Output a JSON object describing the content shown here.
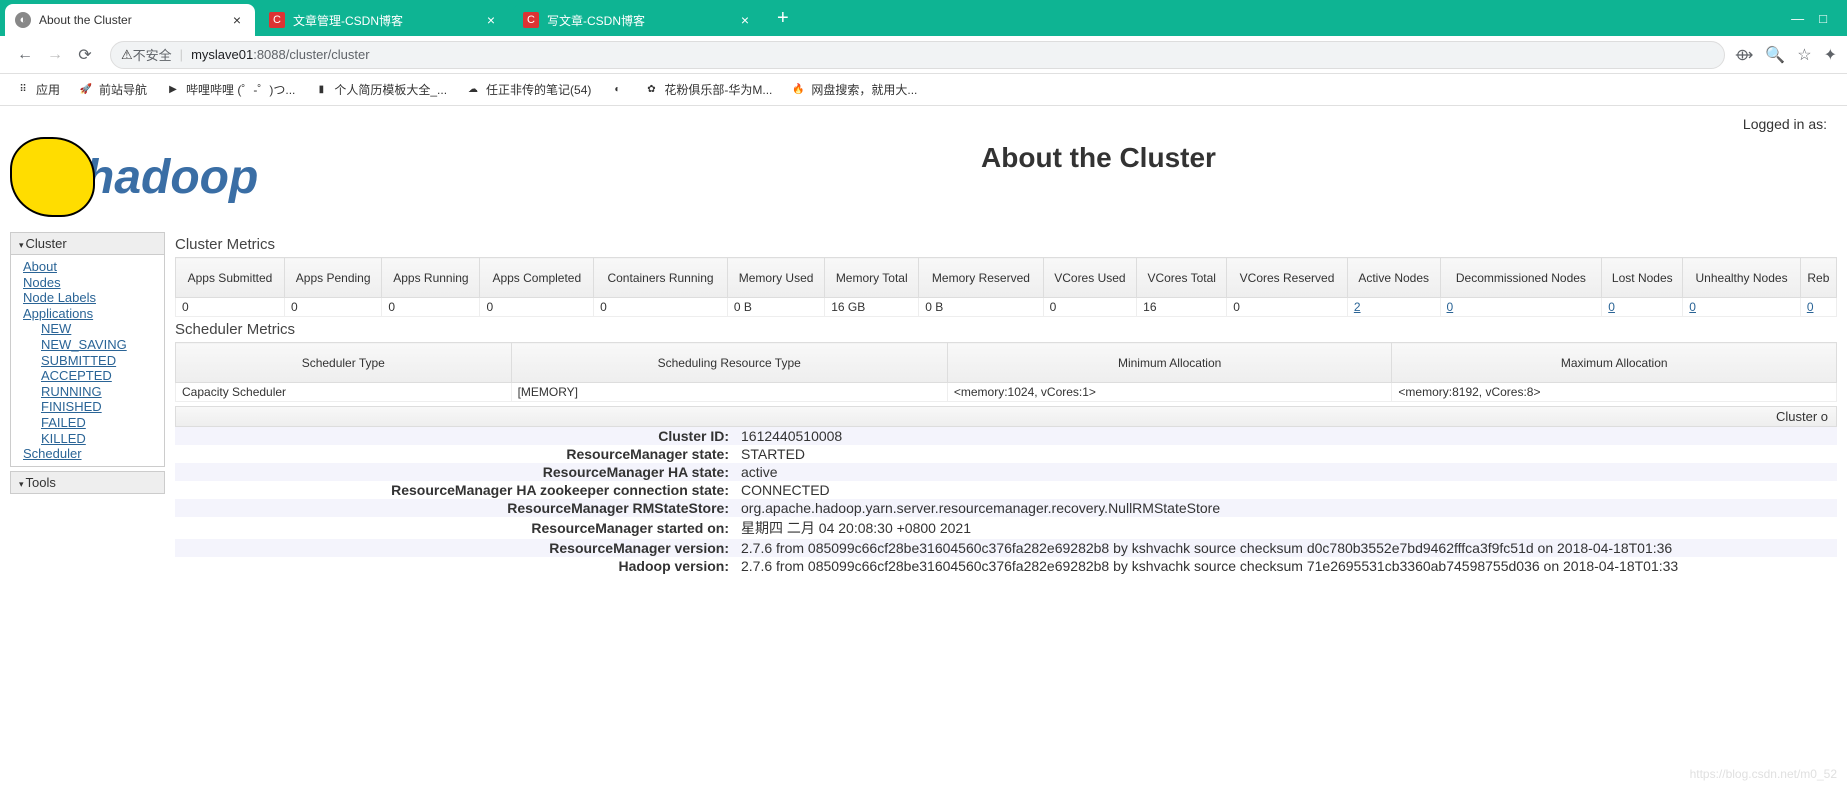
{
  "browser": {
    "tabs": [
      {
        "title": "About the Cluster",
        "favicon": "globe",
        "active": true
      },
      {
        "title": "文章管理-CSDN博客",
        "favicon": "C",
        "active": false
      },
      {
        "title": "写文章-CSDN博客",
        "favicon": "C",
        "active": false
      }
    ],
    "insecure_label": "不安全",
    "url_host": "myslave01",
    "url_rest": ":8088/cluster/cluster",
    "bookmarks": [
      {
        "label": "应用",
        "icon": "apps"
      },
      {
        "label": "前站导航",
        "icon": "rocket"
      },
      {
        "label": "哔哩哔哩 (゜-゜)つ...",
        "icon": "bili"
      },
      {
        "label": "个人简历模板大全_...",
        "icon": "doc"
      },
      {
        "label": "任正非传的笔记(54)",
        "icon": "note"
      },
      {
        "label": "",
        "icon": "globe"
      },
      {
        "label": "花粉俱乐部-华为M...",
        "icon": "hw"
      },
      {
        "label": "网盘搜索，就用大...",
        "icon": "fire"
      }
    ]
  },
  "page": {
    "logged_in": "Logged in as:",
    "logo_text": "hadoop",
    "title": "About the Cluster"
  },
  "sidebar": {
    "cluster_hdr": "Cluster",
    "cluster_items": [
      "About",
      "Nodes",
      "Node Labels",
      "Applications"
    ],
    "app_states": [
      "NEW",
      "NEW_SAVING",
      "SUBMITTED",
      "ACCEPTED",
      "RUNNING",
      "FINISHED",
      "FAILED",
      "KILLED"
    ],
    "scheduler": "Scheduler",
    "tools_hdr": "Tools"
  },
  "cluster_metrics": {
    "title": "Cluster Metrics",
    "headers": [
      "Apps Submitted",
      "Apps Pending",
      "Apps Running",
      "Apps Completed",
      "Containers Running",
      "Memory Used",
      "Memory Total",
      "Memory Reserved",
      "VCores Used",
      "VCores Total",
      "VCores Reserved",
      "Active Nodes",
      "Decommissioned Nodes",
      "Lost Nodes",
      "Unhealthy Nodes",
      "Reb"
    ],
    "values": [
      "0",
      "0",
      "0",
      "0",
      "0",
      "0 B",
      "16 GB",
      "0 B",
      "0",
      "16",
      "0",
      "2",
      "0",
      "0",
      "0",
      "0"
    ],
    "links_from_index": 11
  },
  "scheduler_metrics": {
    "title": "Scheduler Metrics",
    "headers": [
      "Scheduler Type",
      "Scheduling Resource Type",
      "Minimum Allocation",
      "Maximum Allocation"
    ],
    "values": [
      "Capacity Scheduler",
      "[MEMORY]",
      "<memory:1024, vCores:1>",
      "<memory:8192, vCores:8>"
    ]
  },
  "overview": {
    "header": "Cluster o",
    "rows": [
      {
        "k": "Cluster ID:",
        "v": "1612440510008"
      },
      {
        "k": "ResourceManager state:",
        "v": "STARTED"
      },
      {
        "k": "ResourceManager HA state:",
        "v": "active"
      },
      {
        "k": "ResourceManager HA zookeeper connection state:",
        "v": "CONNECTED"
      },
      {
        "k": "ResourceManager RMStateStore:",
        "v": "org.apache.hadoop.yarn.server.resourcemanager.recovery.NullRMStateStore"
      },
      {
        "k": "ResourceManager started on:",
        "v": "星期四 二月 04 20:08:30 +0800 2021"
      },
      {
        "k": "ResourceManager version:",
        "v": "2.7.6 from 085099c66cf28be31604560c376fa282e69282b8 by kshvachk source checksum d0c780b3552e7bd9462fffca3f9fc51d on 2018-04-18T01:36"
      },
      {
        "k": "Hadoop version:",
        "v": "2.7.6 from 085099c66cf28be31604560c376fa282e69282b8 by kshvachk source checksum 71e2695531cb3360ab74598755d036 on 2018-04-18T01:33"
      }
    ]
  },
  "watermark": "https://blog.csdn.net/m0_52"
}
